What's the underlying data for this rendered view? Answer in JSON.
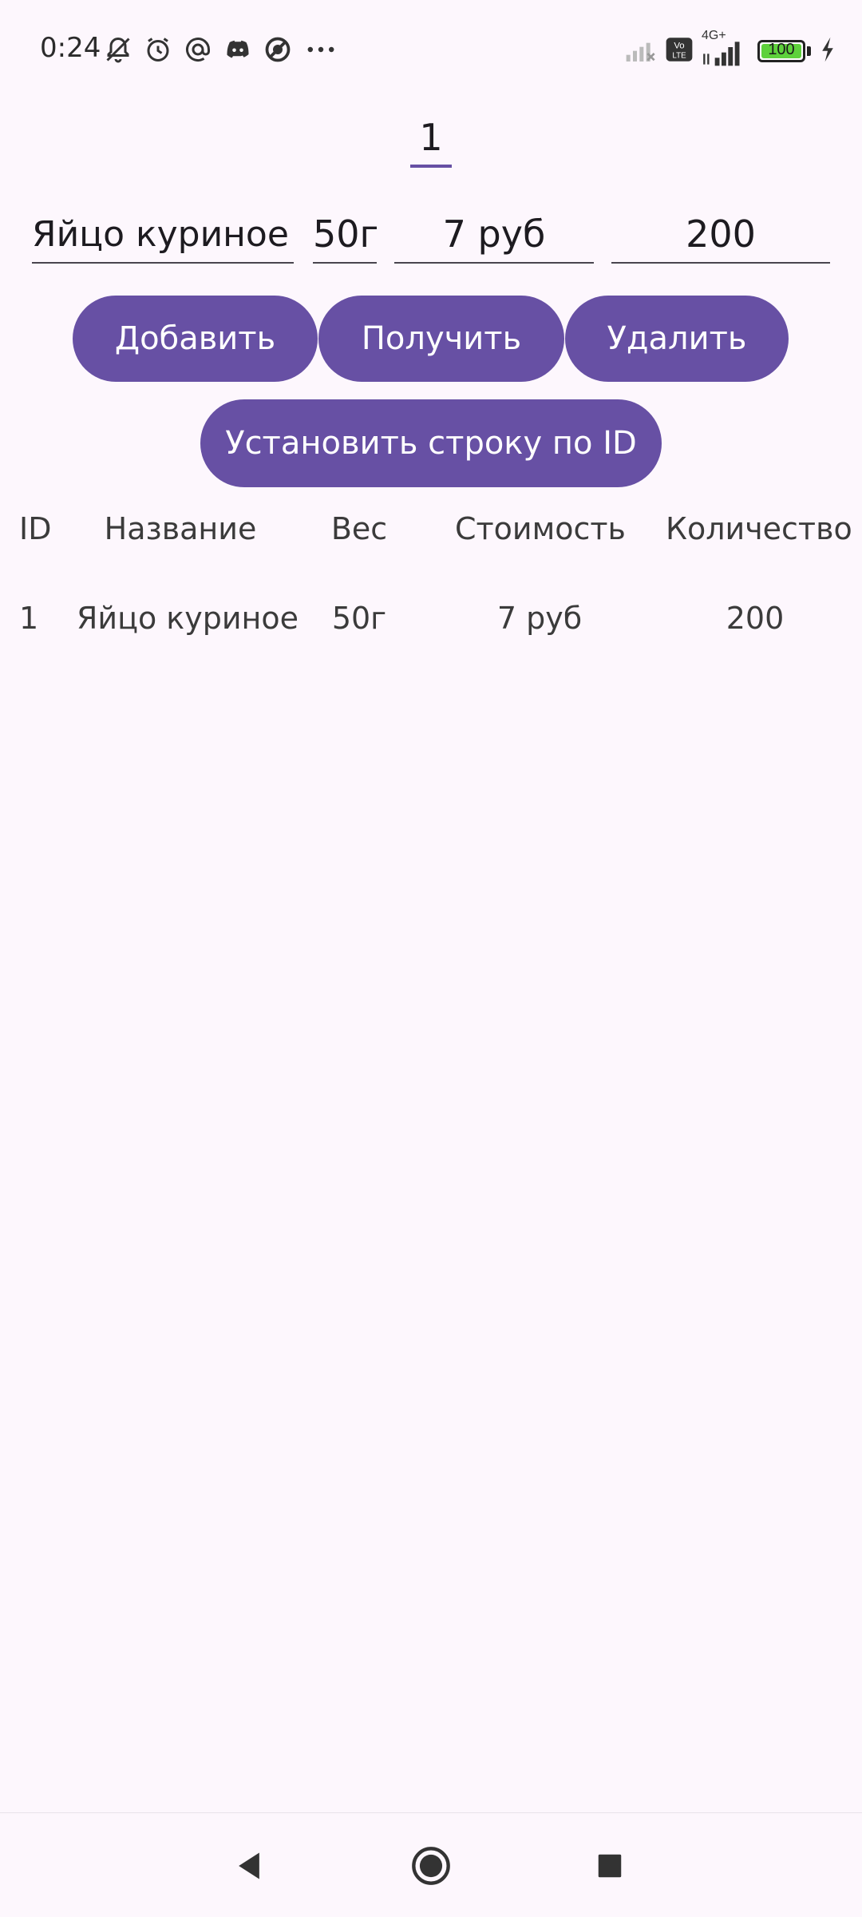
{
  "status_bar": {
    "time": "0:24",
    "battery_level": "100",
    "network": "4G+",
    "volte": "Vo LTE",
    "icons": [
      "bell-off-icon",
      "alarm-icon",
      "at-icon",
      "discord-icon",
      "no-sign-icon",
      "more-dots-icon",
      "signal-off-icon",
      "volte-icon",
      "signal-icon",
      "battery-icon",
      "charging-icon"
    ]
  },
  "id_field": {
    "value": "1"
  },
  "inputs": {
    "name": "Яйцо куриное",
    "weight": "50г",
    "cost": "7 руб",
    "quantity": "200"
  },
  "buttons": {
    "add": "Добавить",
    "get": "Получить",
    "delete": "Удалить",
    "set_row": "Установить строку по ID"
  },
  "table": {
    "headers": {
      "id": "ID",
      "name": "Название",
      "weight": "Вес",
      "cost": "Стоимость",
      "quantity": "Количество"
    },
    "rows": [
      {
        "id": "1",
        "name": "Яйцо куриное",
        "weight": "50г",
        "cost": "7 руб",
        "quantity": "200"
      }
    ]
  },
  "colors": {
    "accent": "#6750A4",
    "background": "#FDF7FD",
    "battery_fill": "#5ed13c"
  },
  "nav_bar": {
    "icons": [
      "back-icon",
      "home-icon",
      "recents-icon"
    ]
  }
}
